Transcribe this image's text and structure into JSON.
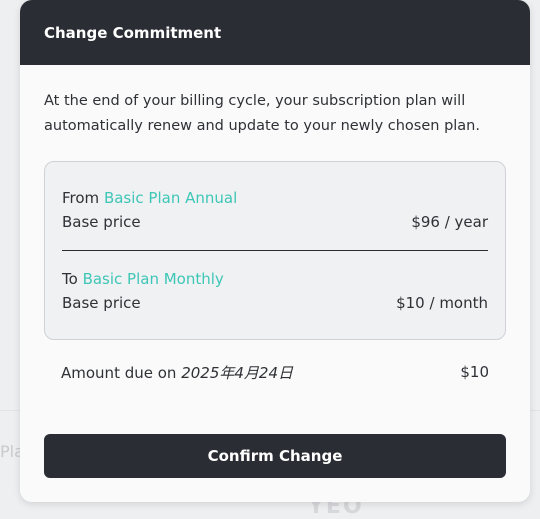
{
  "background": {
    "partial_text": "Pla",
    "partial_logo": "YEO"
  },
  "modal": {
    "title": "Change Commitment",
    "intro": "At the end of your billing cycle, your subscription plan will automatically renew and update to your newly chosen plan.",
    "from": {
      "prefix": "From",
      "plan_name": "Basic Plan Annual",
      "price_label": "Base price",
      "price_value": "$96 / year"
    },
    "to": {
      "prefix": "To",
      "plan_name": "Basic Plan Monthly",
      "price_label": "Base price",
      "price_value": "$10 / month"
    },
    "amount_due": {
      "label": "Amount due on",
      "date": "2025年4月24日",
      "value": "$10"
    },
    "confirm_label": "Confirm Change"
  },
  "colors": {
    "header_bg": "#2a2d33",
    "accent": "#3ec6b6",
    "button_bg": "#2a2d33"
  }
}
